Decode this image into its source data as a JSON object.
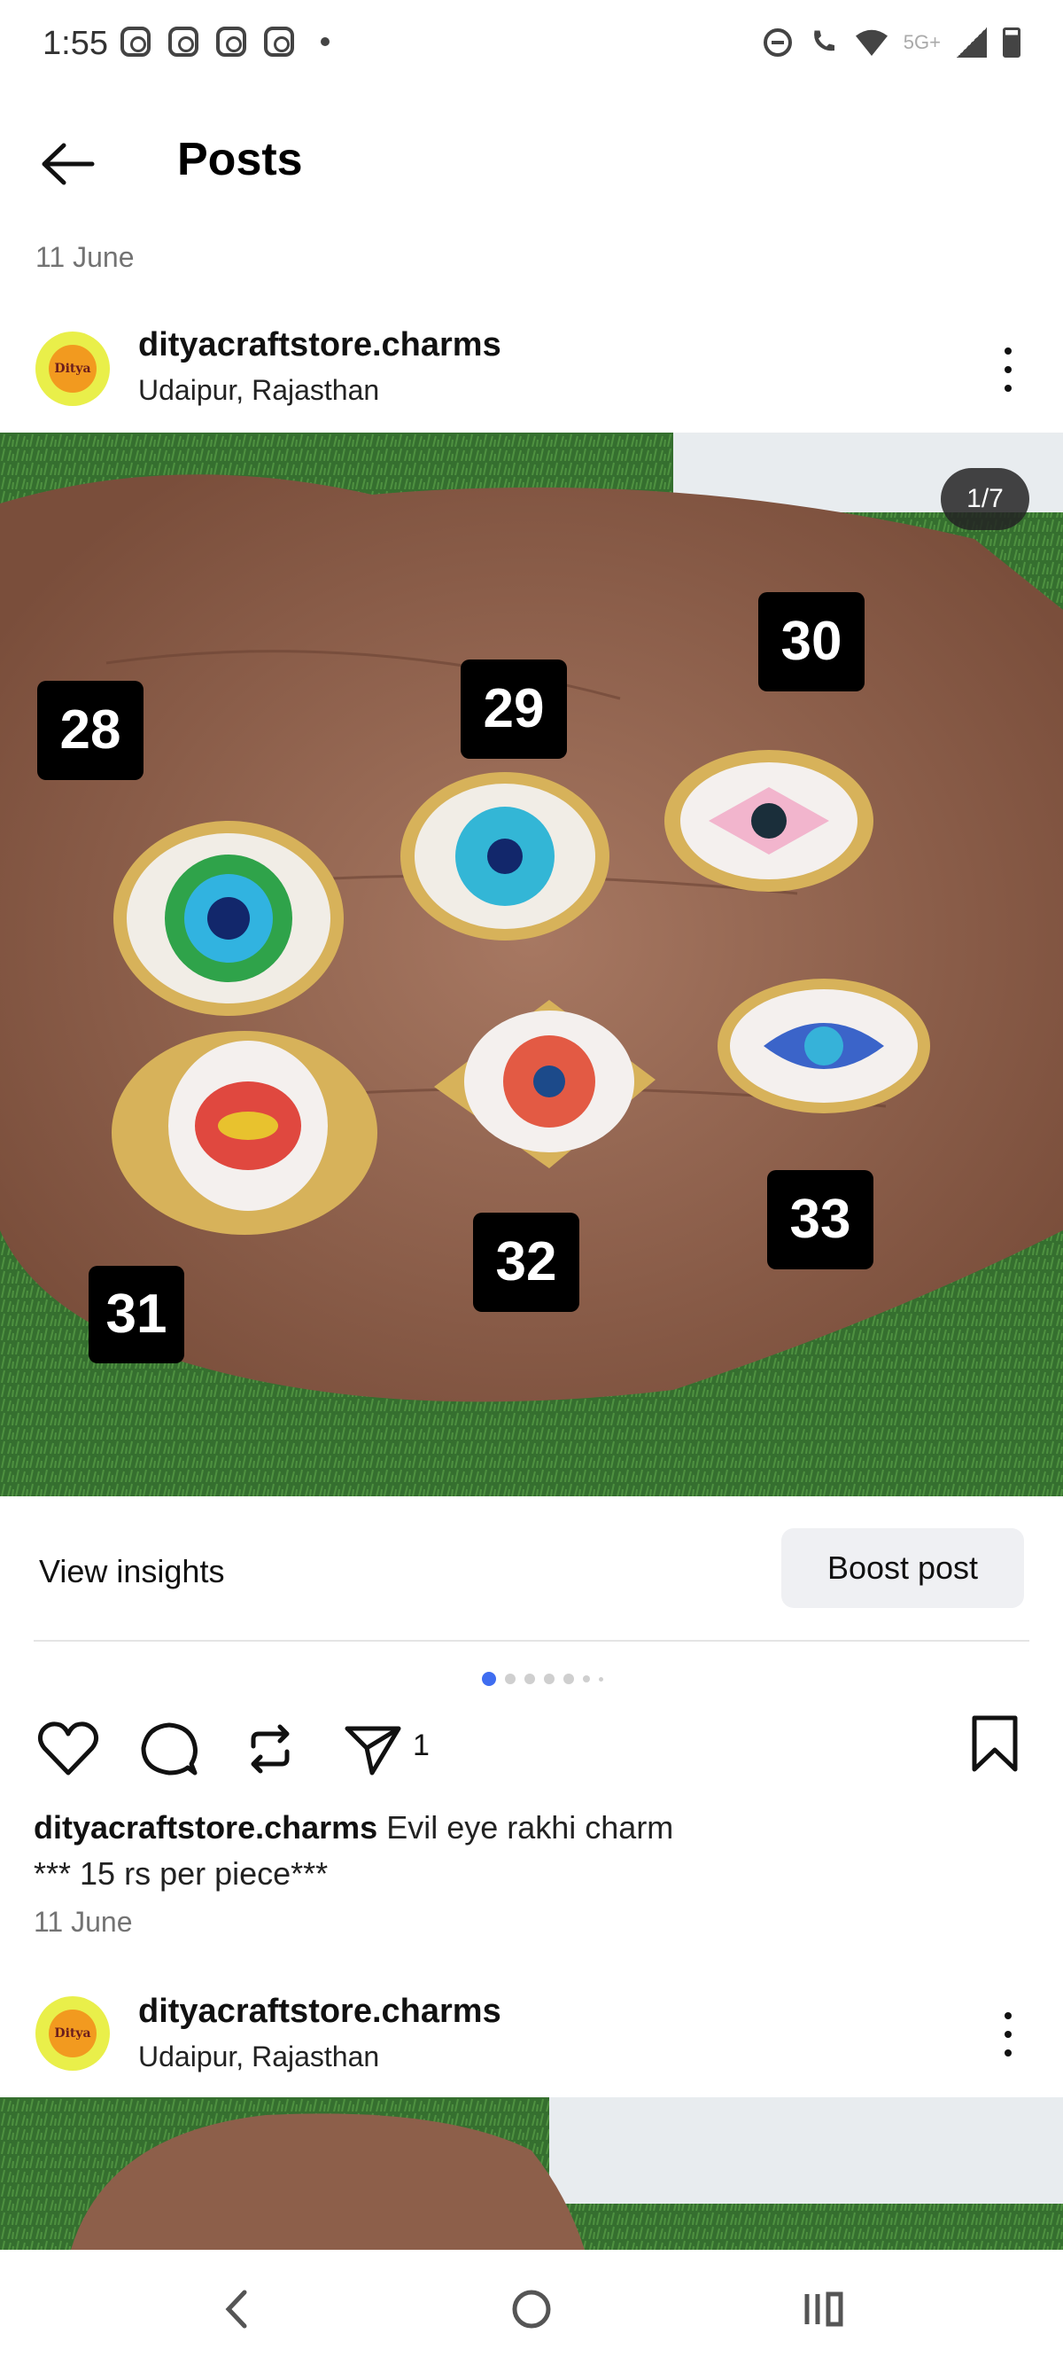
{
  "status_bar": {
    "time": "1:55",
    "network": "5G+"
  },
  "header": {
    "title": "Posts"
  },
  "posts": [
    {
      "date": "11 June",
      "username": "dityacraftstore.charms",
      "location": "Udaipur, Rajasthan",
      "avatar_text": "Ditya",
      "image_counter": "1/7",
      "image_labels": [
        "28",
        "29",
        "30",
        "31",
        "32",
        "33"
      ],
      "view_insights": "View insights",
      "boost_post": "Boost post",
      "share_count": "1",
      "caption_user": "dityacraftstore.charms",
      "caption_text": "Evil eye rakhi charm",
      "caption_line2": "*** 15 rs per piece***",
      "caption_date": "11 June"
    },
    {
      "username": "dityacraftstore.charms",
      "location": "Udaipur, Rajasthan",
      "avatar_text": "Ditya"
    }
  ],
  "icons": {
    "back": "back-arrow-icon",
    "like": "heart-icon",
    "comment": "comment-icon",
    "repost": "repost-icon",
    "share": "send-icon",
    "save": "bookmark-icon",
    "more": "more-options-icon"
  },
  "colors": {
    "accent_dot": "#3f6df0",
    "secondary_text": "#737373",
    "boost_bg": "#eff0f3"
  }
}
